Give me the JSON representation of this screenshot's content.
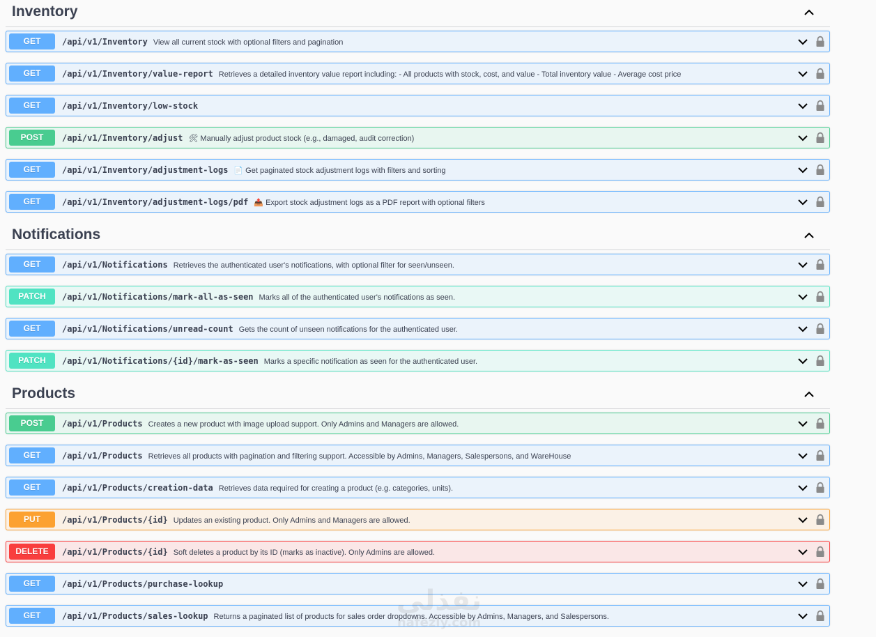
{
  "sections": [
    {
      "key": "inventory",
      "title": "Inventory",
      "operations": [
        {
          "method": "GET",
          "path": "/api/v1/Inventory",
          "description": "View all current stock with optional filters and pagination"
        },
        {
          "method": "GET",
          "path": "/api/v1/Inventory/value-report",
          "description": "Retrieves a detailed inventory value report including: - All products with stock, cost, and value - Total inventory value - Average cost price"
        },
        {
          "method": "GET",
          "path": "/api/v1/Inventory/low-stock",
          "description": ""
        },
        {
          "method": "POST",
          "path": "/api/v1/Inventory/adjust",
          "description": "🛠 Manually adjust product stock (e.g., damaged, audit correction)"
        },
        {
          "method": "GET",
          "path": "/api/v1/Inventory/adjustment-logs",
          "description": "📄 Get paginated stock adjustment logs with filters and sorting"
        },
        {
          "method": "GET",
          "path": "/api/v1/Inventory/adjustment-logs/pdf",
          "description": "📤 Export stock adjustment logs as a PDF report with optional filters"
        }
      ]
    },
    {
      "key": "notifications",
      "title": "Notifications",
      "operations": [
        {
          "method": "GET",
          "path": "/api/v1/Notifications",
          "description": "Retrieves the authenticated user's notifications, with optional filter for seen/unseen."
        },
        {
          "method": "PATCH",
          "path": "/api/v1/Notifications/mark-all-as-seen",
          "description": "Marks all of the authenticated user's notifications as seen."
        },
        {
          "method": "GET",
          "path": "/api/v1/Notifications/unread-count",
          "description": "Gets the count of unseen notifications for the authenticated user."
        },
        {
          "method": "PATCH",
          "path": "/api/v1/Notifications/{id}/mark-as-seen",
          "description": "Marks a specific notification as seen for the authenticated user."
        }
      ]
    },
    {
      "key": "products",
      "title": "Products",
      "operations": [
        {
          "method": "POST",
          "path": "/api/v1/Products",
          "description": "Creates a new product with image upload support. Only Admins and Managers are allowed."
        },
        {
          "method": "GET",
          "path": "/api/v1/Products",
          "description": "Retrieves all products with pagination and filtering support. Accessible by Admins, Managers, Salespersons, and WareHouse"
        },
        {
          "method": "GET",
          "path": "/api/v1/Products/creation-data",
          "description": "Retrieves data required for creating a product (e.g. categories, units)."
        },
        {
          "method": "PUT",
          "path": "/api/v1/Products/{id}",
          "description": "Updates an existing product. Only Admins and Managers are allowed."
        },
        {
          "method": "DELETE",
          "path": "/api/v1/Products/{id}",
          "description": "Soft deletes a product by its ID (marks as inactive). Only Admins are allowed."
        },
        {
          "method": "GET",
          "path": "/api/v1/Products/purchase-lookup",
          "description": ""
        },
        {
          "method": "GET",
          "path": "/api/v1/Products/sales-lookup",
          "description": "Returns a paginated list of products for sales order dropdowns. Accessible by Admins, Managers, and Salespersons."
        }
      ]
    }
  ],
  "icons": {
    "collapse": "chevron-up-icon",
    "expand": "chevron-down-icon",
    "auth": "lock-icon"
  },
  "colors": {
    "GET": "#61affe",
    "POST": "#49cc90",
    "PATCH": "#50e3c2",
    "PUT": "#fca130",
    "DELETE": "#f93e3e"
  },
  "watermark": {
    "main": "نفذلي",
    "sub": "nafezly.com"
  }
}
